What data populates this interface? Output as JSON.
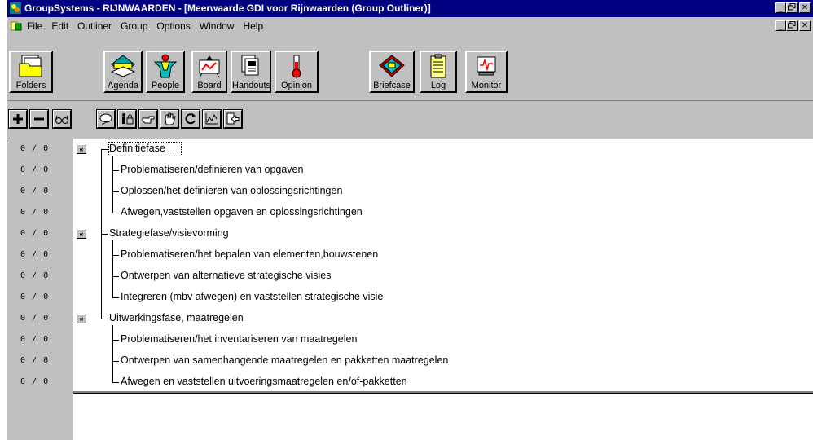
{
  "titlebar": {
    "title": "GroupSystems - RIJNWAARDEN - [Meerwaarde GDI voor Rijnwaarden (Group Outliner)]"
  },
  "window_buttons": {
    "minimize": "_",
    "maximize": "🗗",
    "close": "✕"
  },
  "menu": {
    "items": [
      {
        "label": "File"
      },
      {
        "label": "Edit"
      },
      {
        "label": "Outliner"
      },
      {
        "label": "Group"
      },
      {
        "label": "Options"
      },
      {
        "label": "Window"
      },
      {
        "label": "Help"
      }
    ]
  },
  "toolbar": {
    "folders": "Folders",
    "agenda": "Agenda",
    "people": "People",
    "board": "Board",
    "handouts": "Handouts",
    "opinion": "Opinion",
    "briefcase": "Briefcase",
    "log": "Log",
    "monitor": "Monitor"
  },
  "small_toolbar": {
    "add": "add-icon",
    "remove": "remove-icon",
    "view": "glasses-icon",
    "comment": "speech-bubble-icon",
    "anonymous": "person-lock-icon",
    "point": "pointing-hand-icon",
    "raise_hand": "hand-icon",
    "refresh": "refresh-icon",
    "chart": "chart-icon",
    "exit": "exit-icon"
  },
  "outline": {
    "rows": [
      {
        "count": "0 / 0",
        "text": "Definitiefase",
        "level": 0
      },
      {
        "count": "0 / 0",
        "text": "Problematiseren/definieren van opgaven",
        "level": 1
      },
      {
        "count": "0 / 0",
        "text": "Oplossen/het definieren van oplossingsrichtingen",
        "level": 1
      },
      {
        "count": "0 / 0",
        "text": "Afwegen,vaststellen opgaven en oplossingsrichtingen",
        "level": 1
      },
      {
        "count": "0 / 0",
        "text": "Strategiefase/visievorming",
        "level": 0
      },
      {
        "count": "0 / 0",
        "text": "Problematiseren/het bepalen van elementen,bouwstenen",
        "level": 1
      },
      {
        "count": "0 / 0",
        "text": "Ontwerpen van alternatieve strategische visies",
        "level": 1
      },
      {
        "count": "0 / 0",
        "text": "Integreren (mbv afwegen) en vaststellen  strategische visie",
        "level": 1
      },
      {
        "count": "0 / 0",
        "text": "Uitwerkingsfase, maatregelen",
        "level": 0
      },
      {
        "count": "0 / 0",
        "text": "Problematiseren/het inventariseren van maatregelen",
        "level": 1
      },
      {
        "count": "0 / 0",
        "text": "Ontwerpen van samenhangende maatregelen en pakketten maatregelen",
        "level": 1
      },
      {
        "count": "0 / 0",
        "text": "Afwegen en vaststellen uitvoeringsmaatregelen en/of-pakketten",
        "level": 1
      }
    ],
    "collapse_label": "«"
  },
  "colors": {
    "titlebar": "#000080",
    "face": "#c0c0c0"
  }
}
